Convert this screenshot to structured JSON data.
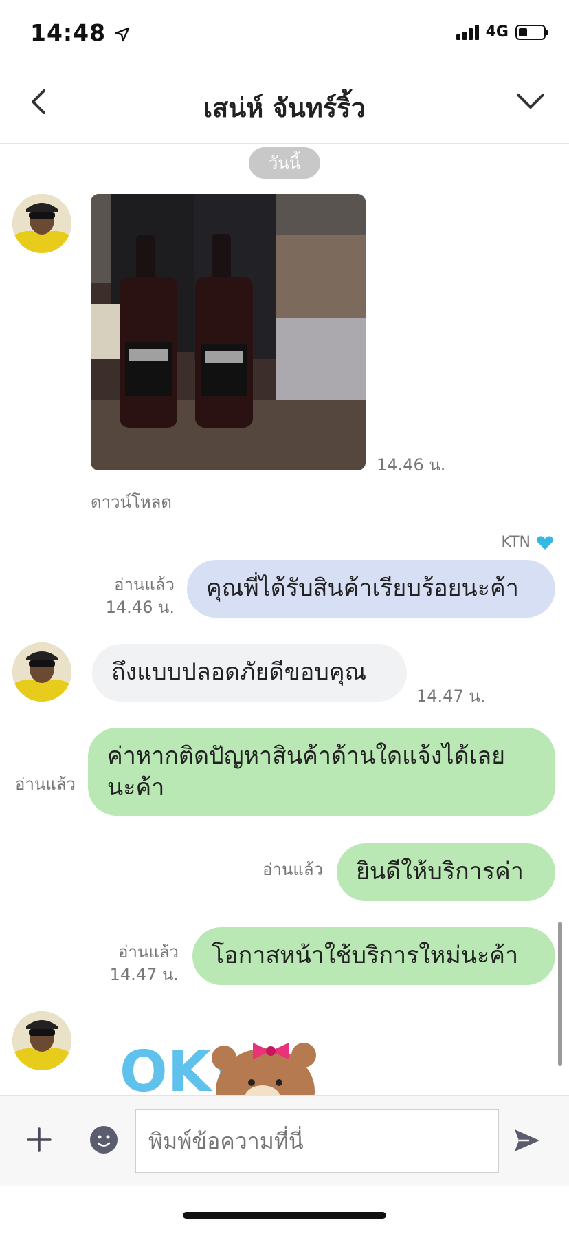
{
  "status_bar": {
    "time": "14:48",
    "network": "4G"
  },
  "header": {
    "title": "เสน่ห์ จันทร์ริ้ว"
  },
  "chat": {
    "date_label": "วันนี้",
    "photo_time": "14.46 น.",
    "download_label": "ดาวน์โหลด",
    "sender_tag": "KTN",
    "messages": [
      {
        "text": "คุณพี่ได้รับสินค้าเรียบร้อยนะค้า",
        "read": "อ่านแล้ว",
        "time": "14.46 น."
      },
      {
        "text": "ถึงแบบปลอดภัยดีขอบคุณ",
        "time": "14.47 น."
      },
      {
        "line1": "ค่าหากติดปัญหาสินค้าด้านใดแจ้งได้เลย",
        "line2": "นะค้า",
        "read": "อ่านแล้ว"
      },
      {
        "text": "ยินดีให้บริการค่า",
        "read": "อ่านแล้ว"
      },
      {
        "text": "โอกาสหน้าใช้บริการใหม่นะค้า",
        "read": "อ่านแล้ว",
        "time": "14.47 น."
      }
    ],
    "sticker_text": "OK!"
  },
  "input": {
    "placeholder": "พิมพ์ข้อความที่นี่"
  },
  "colors": {
    "bubble_in": "#f1f2f4",
    "bubble_blue": "#d7dff5",
    "bubble_green": "#b9e8b4",
    "heart": "#35b8e6"
  }
}
